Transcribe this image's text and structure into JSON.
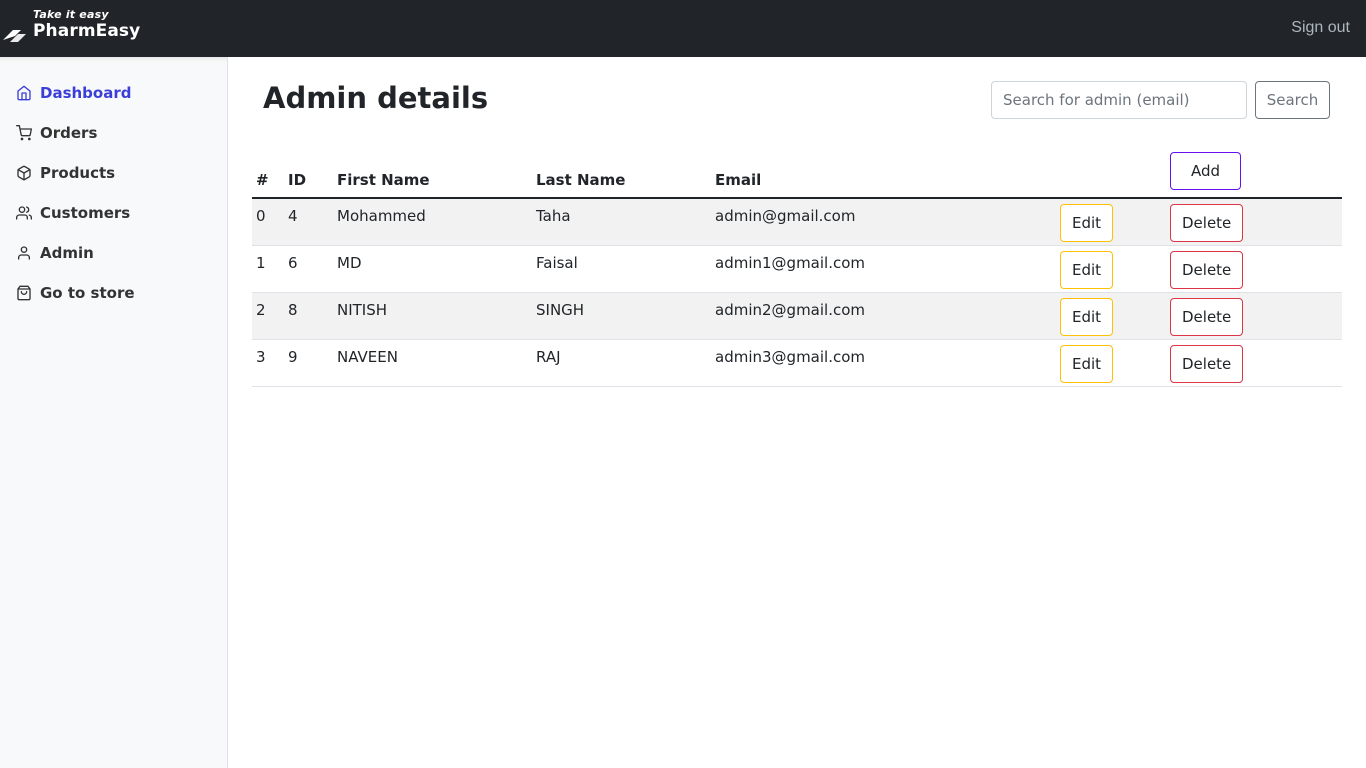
{
  "header": {
    "brand_tagline": "Take it easy",
    "brand_name": "PharmEasy",
    "signout_label": "Sign out"
  },
  "sidebar": {
    "items": [
      {
        "label": "Dashboard",
        "icon": "home-icon",
        "active": true
      },
      {
        "label": "Orders",
        "icon": "cart-icon"
      },
      {
        "label": "Products",
        "icon": "package-icon"
      },
      {
        "label": "Customers",
        "icon": "users-icon"
      },
      {
        "label": "Admin",
        "icon": "user-icon"
      },
      {
        "label": "Go to store",
        "icon": "shopping-bag-icon"
      }
    ]
  },
  "main": {
    "title": "Admin details",
    "search": {
      "placeholder": "Search for admin (email)",
      "value": "",
      "button_label": "Search"
    },
    "table": {
      "headers": [
        "#",
        "ID",
        "First Name",
        "Last Name",
        "Email",
        "",
        "Add"
      ],
      "add_label": "Add",
      "edit_label": "Edit",
      "delete_label": "Delete",
      "rows": [
        {
          "index": "0",
          "id": "4",
          "first_name": "Mohammed",
          "last_name": "Taha",
          "email": "admin@gmail.com"
        },
        {
          "index": "1",
          "id": "6",
          "first_name": "MD",
          "last_name": "Faisal",
          "email": "admin1@gmail.com"
        },
        {
          "index": "2",
          "id": "8",
          "first_name": "NITISH",
          "last_name": "SINGH",
          "email": "admin2@gmail.com"
        },
        {
          "index": "3",
          "id": "9",
          "first_name": "NAVEEN",
          "last_name": "RAJ",
          "email": "admin3@gmail.com"
        }
      ]
    }
  },
  "colors": {
    "topbar": "#212529",
    "sidebar_bg": "#f8f9fa",
    "active_link": "#3b3fd8",
    "edit_border": "#ffc107",
    "delete_border": "#dc3545",
    "add_border": "#6610f2"
  }
}
